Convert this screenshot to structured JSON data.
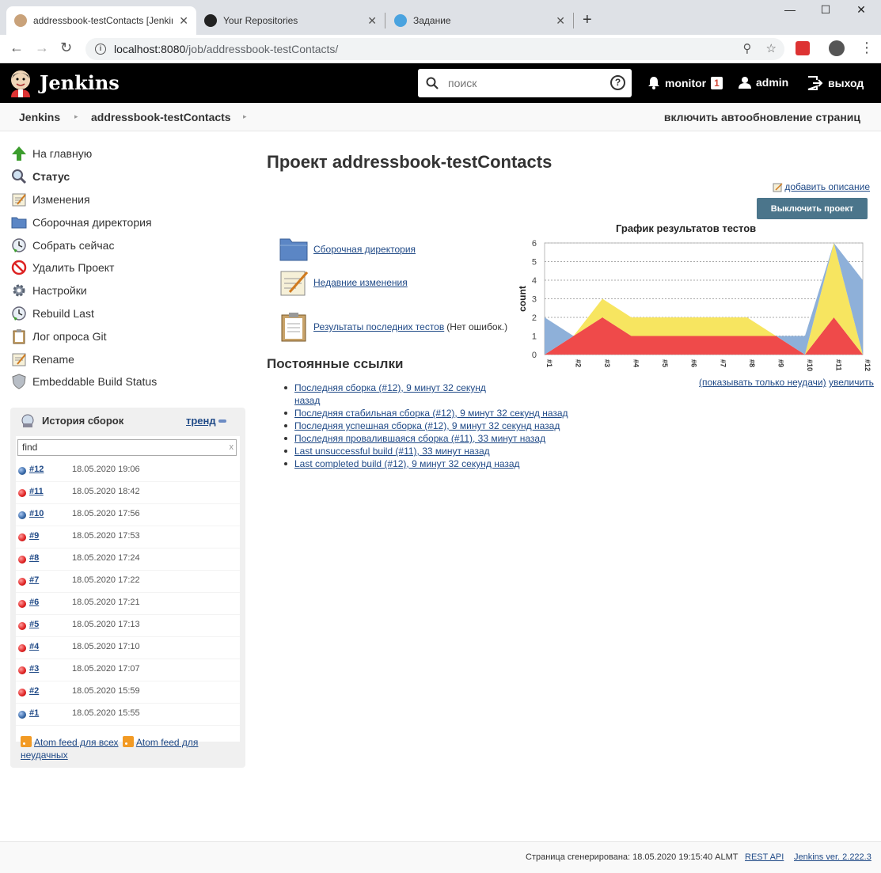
{
  "browser": {
    "tabs": [
      {
        "title": "addressbook-testContacts [Jenkins]"
      },
      {
        "title": "Your Repositories"
      },
      {
        "title": "Задание"
      }
    ],
    "url_host": "localhost:8080",
    "url_path": "/job/addressbook-testContacts/"
  },
  "header": {
    "brand": "Jenkins",
    "search_placeholder": "поиск",
    "monitor_label": "monitor",
    "monitor_count": "1",
    "user": "admin",
    "logout": "выход"
  },
  "breadcrumb": {
    "items": [
      "Jenkins",
      "addressbook-testContacts"
    ],
    "autorefresh": "включить автообновление страниц"
  },
  "sidebar": {
    "tasks": [
      {
        "label": "На главную",
        "icon": "up-arrow-icon"
      },
      {
        "label": "Статус",
        "icon": "magnifier-icon"
      },
      {
        "label": "Изменения",
        "icon": "notepad-icon"
      },
      {
        "label": "Сборочная директория",
        "icon": "folder-icon"
      },
      {
        "label": "Собрать сейчас",
        "icon": "clock-icon"
      },
      {
        "label": "Удалить Проект",
        "icon": "no-entry-icon"
      },
      {
        "label": "Настройки",
        "icon": "gear-icon"
      },
      {
        "label": "Rebuild Last",
        "icon": "clock-icon"
      },
      {
        "label": "Лог опроса Git",
        "icon": "clipboard-icon"
      },
      {
        "label": "Rename",
        "icon": "notepad-icon"
      },
      {
        "label": "Embeddable Build Status",
        "icon": "shield-icon"
      }
    ]
  },
  "build_history": {
    "title": "История сборок",
    "trend": "тренд",
    "find_value": "find",
    "clear": "x",
    "builds": [
      {
        "num": "#12",
        "date": "18.05.2020 19:06",
        "status": "blue"
      },
      {
        "num": "#11",
        "date": "18.05.2020 18:42",
        "status": "red"
      },
      {
        "num": "#10",
        "date": "18.05.2020 17:56",
        "status": "blue"
      },
      {
        "num": "#9",
        "date": "18.05.2020 17:53",
        "status": "red"
      },
      {
        "num": "#8",
        "date": "18.05.2020 17:24",
        "status": "red"
      },
      {
        "num": "#7",
        "date": "18.05.2020 17:22",
        "status": "red"
      },
      {
        "num": "#6",
        "date": "18.05.2020 17:21",
        "status": "red"
      },
      {
        "num": "#5",
        "date": "18.05.2020 17:13",
        "status": "red"
      },
      {
        "num": "#4",
        "date": "18.05.2020 17:10",
        "status": "red"
      },
      {
        "num": "#3",
        "date": "18.05.2020 17:07",
        "status": "red"
      },
      {
        "num": "#2",
        "date": "18.05.2020 15:59",
        "status": "red"
      },
      {
        "num": "#1",
        "date": "18.05.2020 15:55",
        "status": "blue"
      }
    ],
    "feed_all": "Atom feed для всех",
    "feed_failed": "Atom feed для неудачных"
  },
  "main": {
    "title": "Проект addressbook-testContacts",
    "add_description": "добавить описание",
    "disable_button": "Выключить проект",
    "links": [
      {
        "label": "Сборочная директория",
        "icon": "folder-icon",
        "note": ""
      },
      {
        "label": "Недавние изменения",
        "icon": "notepad-icon",
        "note": ""
      },
      {
        "label": "Результаты последних тестов",
        "icon": "clipboard-icon",
        "note": "(Нет ошибок.)"
      }
    ],
    "permalinks_title": "Постоянные ссылки",
    "permalinks": [
      "Последняя сборка (#12), 9 минут 32 секунд назад",
      "Последняя стабильная сборка (#12), 9 минут 32 секунд назад",
      "Последняя успешная сборка (#12), 9 минут 32 секунд назад",
      "Последняя провалившаяся сборка (#11), 33 минут назад",
      "Last unsuccessful build (#11), 33 минут назад",
      "Last completed build (#12), 9 минут 32 секунд назад"
    ],
    "chart_links": {
      "failures_only": "(показывать только неудачи)",
      "enlarge": "увеличить"
    }
  },
  "chart_data": {
    "type": "area",
    "title": "График результатов тестов",
    "ylabel": "count",
    "xlabel": "",
    "categories": [
      "#1",
      "#2",
      "#3",
      "#4",
      "#5",
      "#6",
      "#7",
      "#8",
      "#9",
      "#10",
      "#11",
      "#12"
    ],
    "ylim": [
      0,
      6
    ],
    "yticks": [
      0,
      1,
      2,
      3,
      4,
      5,
      6
    ],
    "grid": true,
    "series": [
      {
        "values": [
          0,
          1,
          2,
          1,
          1,
          1,
          1,
          1,
          1,
          0,
          2,
          0
        ],
        "color": "#ef4a4a"
      },
      {
        "values": [
          0,
          0,
          1,
          1,
          1,
          1,
          1,
          1,
          0,
          0,
          4,
          0
        ],
        "color": "#f7e560"
      },
      {
        "values": [
          2,
          0,
          0,
          0,
          0,
          0,
          0,
          0,
          0,
          1,
          0,
          4
        ],
        "color": "#8eb0d9"
      }
    ]
  },
  "footer": {
    "generated": "Страница сгенерирована: 18.05.2020 19:15:40 ALMT",
    "rest_api": "REST API",
    "version": "Jenkins ver. 2.222.3"
  },
  "colors": {
    "header_bg": "#000000",
    "link": "#204a87",
    "button_bg": "#4b758b"
  }
}
